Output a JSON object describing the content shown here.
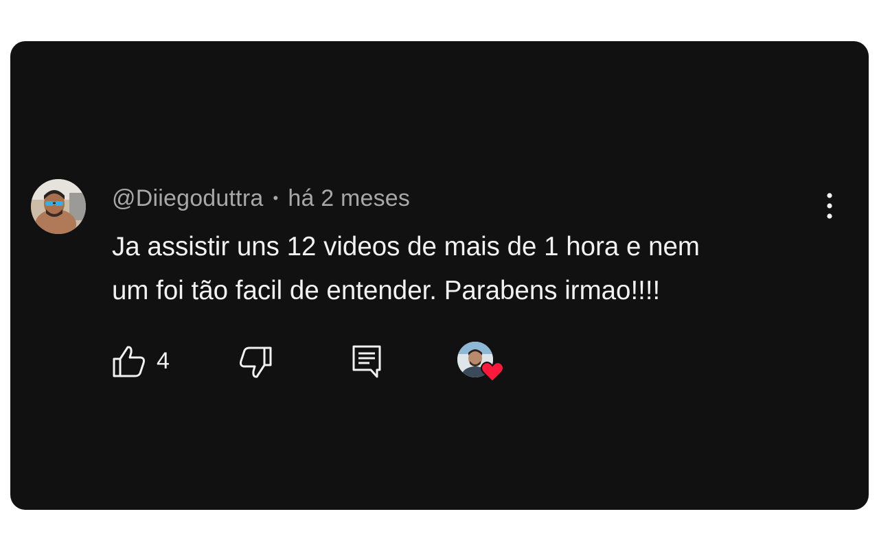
{
  "comment": {
    "author": "@Diiegoduttra",
    "separator": "•",
    "time": "há 2 meses",
    "text_line1": "Ja assistir uns 12 videos de mais de 1 hora e nem",
    "text_line2": "um foi tão facil de entender. Parabens irmao!!!!"
  },
  "actions": {
    "like_count": "4",
    "like_icon": "thumbs-up-icon",
    "dislike_icon": "thumbs-down-icon",
    "reply_icon": "reply-comment-icon",
    "creator_heart_icon": "heart-icon"
  },
  "menu": {
    "icon": "more-vertical-icon"
  },
  "colors": {
    "background": "#111112",
    "author_text": "#a8a8a8",
    "body_text": "#f2f2f2",
    "heart": "#ff1a3c"
  }
}
